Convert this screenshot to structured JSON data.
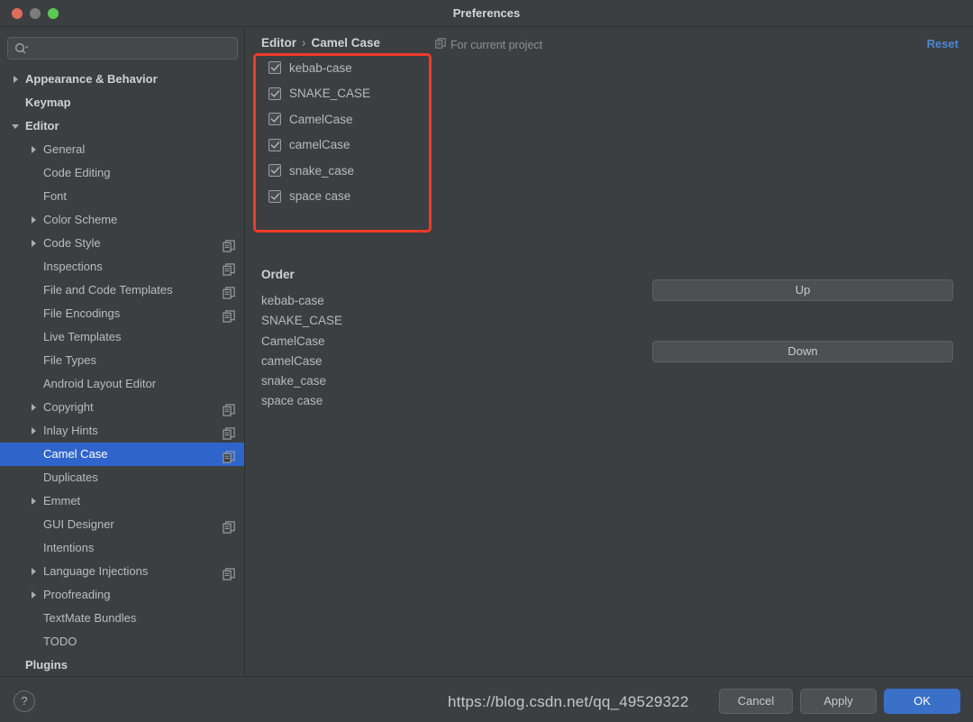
{
  "window": {
    "title": "Preferences",
    "traffic_lights": [
      "close-red",
      "minimize-gray",
      "zoom-green"
    ]
  },
  "sidebar": {
    "search": {
      "value": "",
      "placeholder": "",
      "icon": "search-icon"
    },
    "items": [
      {
        "label": "Appearance & Behavior",
        "depth": 0,
        "bold": true,
        "arrow": "collapsed",
        "badge": false,
        "selected": false
      },
      {
        "label": "Keymap",
        "depth": 0,
        "bold": true,
        "arrow": "none",
        "badge": false,
        "selected": false
      },
      {
        "label": "Editor",
        "depth": 0,
        "bold": true,
        "arrow": "expanded",
        "badge": false,
        "selected": false
      },
      {
        "label": "General",
        "depth": 1,
        "bold": false,
        "arrow": "collapsed",
        "badge": false,
        "selected": false
      },
      {
        "label": "Code Editing",
        "depth": 1,
        "bold": false,
        "arrow": "none",
        "badge": false,
        "selected": false
      },
      {
        "label": "Font",
        "depth": 1,
        "bold": false,
        "arrow": "none",
        "badge": false,
        "selected": false
      },
      {
        "label": "Color Scheme",
        "depth": 1,
        "bold": false,
        "arrow": "collapsed",
        "badge": false,
        "selected": false
      },
      {
        "label": "Code Style",
        "depth": 1,
        "bold": false,
        "arrow": "collapsed",
        "badge": true,
        "selected": false
      },
      {
        "label": "Inspections",
        "depth": 1,
        "bold": false,
        "arrow": "none",
        "badge": true,
        "selected": false
      },
      {
        "label": "File and Code Templates",
        "depth": 1,
        "bold": false,
        "arrow": "none",
        "badge": true,
        "selected": false
      },
      {
        "label": "File Encodings",
        "depth": 1,
        "bold": false,
        "arrow": "none",
        "badge": true,
        "selected": false
      },
      {
        "label": "Live Templates",
        "depth": 1,
        "bold": false,
        "arrow": "none",
        "badge": false,
        "selected": false
      },
      {
        "label": "File Types",
        "depth": 1,
        "bold": false,
        "arrow": "none",
        "badge": false,
        "selected": false
      },
      {
        "label": "Android Layout Editor",
        "depth": 1,
        "bold": false,
        "arrow": "none",
        "badge": false,
        "selected": false
      },
      {
        "label": "Copyright",
        "depth": 1,
        "bold": false,
        "arrow": "collapsed",
        "badge": true,
        "selected": false
      },
      {
        "label": "Inlay Hints",
        "depth": 1,
        "bold": false,
        "arrow": "collapsed",
        "badge": true,
        "selected": false
      },
      {
        "label": "Camel Case",
        "depth": 1,
        "bold": false,
        "arrow": "none",
        "badge": true,
        "selected": true
      },
      {
        "label": "Duplicates",
        "depth": 1,
        "bold": false,
        "arrow": "none",
        "badge": false,
        "selected": false
      },
      {
        "label": "Emmet",
        "depth": 1,
        "bold": false,
        "arrow": "collapsed",
        "badge": false,
        "selected": false
      },
      {
        "label": "GUI Designer",
        "depth": 1,
        "bold": false,
        "arrow": "none",
        "badge": true,
        "selected": false
      },
      {
        "label": "Intentions",
        "depth": 1,
        "bold": false,
        "arrow": "none",
        "badge": false,
        "selected": false
      },
      {
        "label": "Language Injections",
        "depth": 1,
        "bold": false,
        "arrow": "collapsed",
        "badge": true,
        "selected": false
      },
      {
        "label": "Proofreading",
        "depth": 1,
        "bold": false,
        "arrow": "collapsed",
        "badge": false,
        "selected": false
      },
      {
        "label": "TextMate Bundles",
        "depth": 1,
        "bold": false,
        "arrow": "none",
        "badge": false,
        "selected": false
      },
      {
        "label": "TODO",
        "depth": 1,
        "bold": false,
        "arrow": "none",
        "badge": false,
        "selected": false
      },
      {
        "label": "Plugins",
        "depth": 0,
        "bold": true,
        "arrow": "none",
        "badge": false,
        "selected": false
      }
    ]
  },
  "main": {
    "breadcrumb": {
      "root": "Editor",
      "separator": "›",
      "leaf": "Camel Case"
    },
    "scope": {
      "icon": "copy-icon",
      "label": "For current project"
    },
    "reset": {
      "label": "Reset",
      "color": "#4a88d4"
    },
    "checkboxes": [
      {
        "label": "kebab-case",
        "checked": true
      },
      {
        "label": "SNAKE_CASE",
        "checked": true
      },
      {
        "label": "CamelCase",
        "checked": true
      },
      {
        "label": "camelCase",
        "checked": true
      },
      {
        "label": "snake_case",
        "checked": true
      },
      {
        "label": "space case",
        "checked": true
      }
    ],
    "highlight": {
      "color": "#f03a26",
      "shape": "rounded-rectangle"
    },
    "order": {
      "title": "Order",
      "items": [
        "kebab-case",
        "SNAKE_CASE",
        "CamelCase",
        "camelCase",
        "snake_case",
        "space case"
      ]
    },
    "move_buttons": {
      "up": "Up",
      "down": "Down"
    }
  },
  "footer": {
    "help": "?",
    "cancel": "Cancel",
    "apply": "Apply",
    "ok": "OK"
  },
  "watermark": "https://blog.csdn.net/qq_49529322"
}
